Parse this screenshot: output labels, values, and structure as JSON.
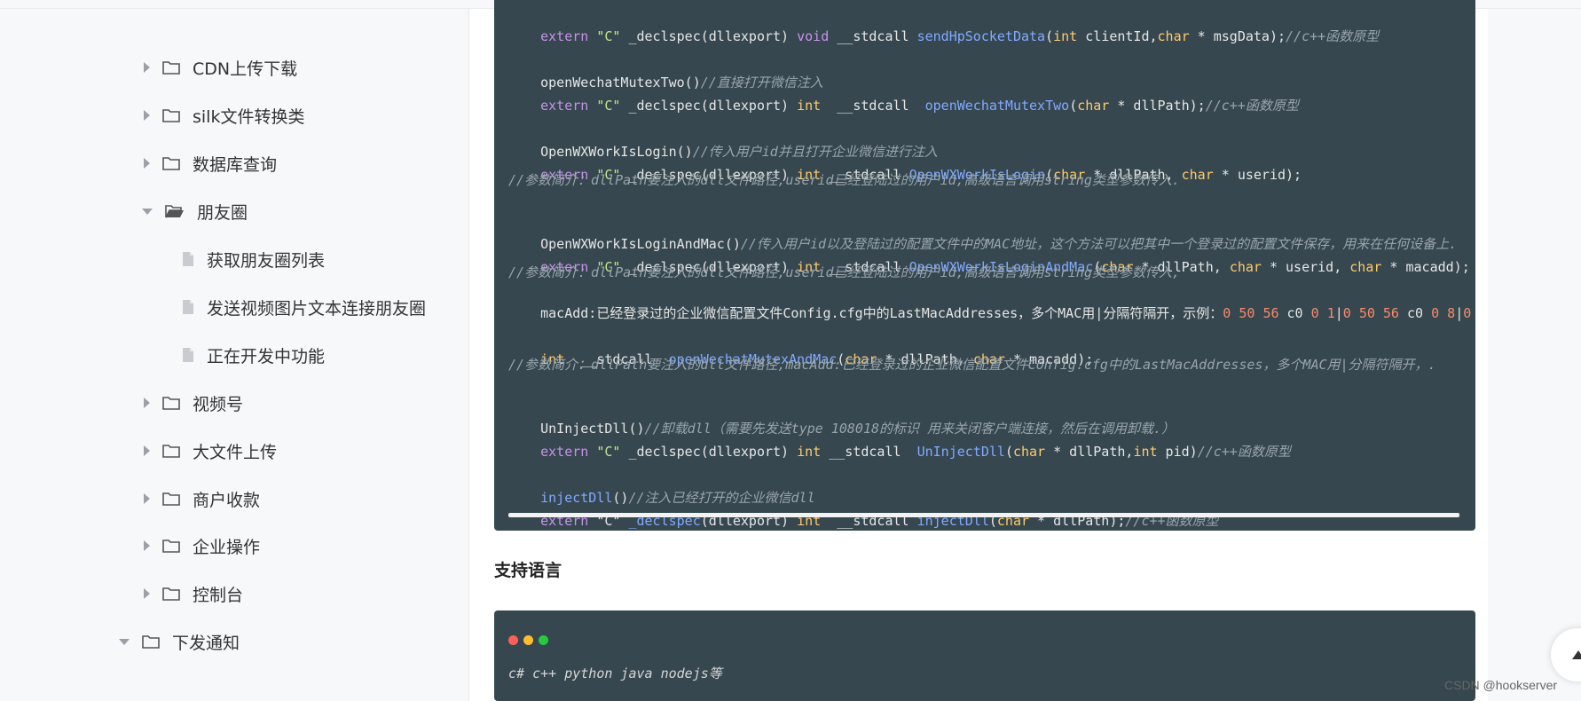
{
  "sidebar": {
    "items": [
      {
        "label": "CDN上传下载",
        "state": "collapsed"
      },
      {
        "label": "silk文件转换类",
        "state": "collapsed"
      },
      {
        "label": "数据库查询",
        "state": "collapsed"
      },
      {
        "label": "朋友圈",
        "state": "expanded",
        "children": [
          "获取朋友圈列表",
          "发送视频图片文本连接朋友圈",
          "正在开发中功能"
        ]
      },
      {
        "label": "视频号",
        "state": "collapsed"
      },
      {
        "label": "大文件上传",
        "state": "collapsed"
      },
      {
        "label": "商户收款",
        "state": "collapsed"
      },
      {
        "label": "企业操作",
        "state": "collapsed"
      },
      {
        "label": "控制台",
        "state": "collapsed"
      },
      {
        "label": "下发通知",
        "state": "expanded"
      }
    ]
  },
  "code": {
    "line1": [
      "extern",
      " \"C\"",
      " _declspec(dllexport) ",
      "void",
      " __stdcall ",
      "sendHpSocketData",
      "(",
      "int",
      " clientId,",
      "char",
      " * msgData);",
      "//c++函数原型"
    ],
    "line2": [
      "openWechatMutexTwo()",
      "//直接打开微信注入"
    ],
    "line3": [
      "extern",
      " \"C\"",
      " _declspec(dllexport) ",
      "int",
      "  __stdcall  ",
      "openWechatMutexTwo",
      "(",
      "char",
      " * dllPath);",
      "//c++函数原型"
    ],
    "line4": [
      "OpenWXWorkIsLogin()",
      "//传入用户id并且打开企业微信进行注入"
    ],
    "line5": [
      "extern",
      " \"C\"",
      " _declspec(dllexport) ",
      "int",
      " __stdcall ",
      "OpenWXWorkIsLogin",
      "(",
      "char",
      " * dllPath, ",
      "char",
      " * userid);"
    ],
    "line6": [
      "//参数简介：dllPath要注入的dll文件路径,userid已经登陆过的用户id,高级语言调用string类型参数传入."
    ],
    "line7": [
      "OpenWXWorkIsLoginAndMac()",
      "//传入用户id以及登陆过的配置文件中的MAC地址，这个方法可以把其中一个登录过的配置文件保存，用来在任何设备上."
    ],
    "line8": [
      "extern",
      " \"C\"",
      " _declspec(dllexport) ",
      "int",
      " __stdcall ",
      "OpenWXWorkIsLoginAndMac",
      "(",
      "char",
      " * dllPath, ",
      "char",
      " * userid, ",
      "char",
      " * macadd);"
    ],
    "line9": [
      "//参数简介：dllPath要注入的dll文件路径,userid已经登陆过的用户id,高级语言调用string类型参数传入,"
    ],
    "line10": [
      "macAdd:已经登录过的企业微信配置文件Config.cfg中的LastMacAddresses，多个MAC用|分隔符隔开，示例：",
      "0",
      " ",
      "50",
      " ",
      "56",
      " c0 ",
      "0",
      " ",
      "1",
      "|",
      "0",
      " ",
      "50",
      " ",
      "56",
      " c0 ",
      "0",
      " ",
      "8",
      "|",
      "0"
    ],
    "line11": [
      "int",
      "  __stdcall  ",
      "openWechatMutexAndMac",
      "(",
      "char",
      " * dllPath, ",
      "char",
      " * macadd);"
    ],
    "line12": [
      "//参数简介：dllPath要注入的dll文件路径,macAdd:已经登录过的企业微信配置文件Config.cfg中的LastMacAddresses，多个MAC用|分隔符隔开，."
    ],
    "line13": [
      "UnInjectDll()",
      "//卸载dll（需要先发送type 108018的标识 用来关闭客户端连接，然后在调用卸载.）"
    ],
    "line14": [
      "extern",
      " \"C\"",
      " _declspec(dllexport) ",
      "int",
      " __stdcall  ",
      "UnInjectDll",
      "(",
      "char",
      " * dllPath,",
      "int",
      " pid)",
      "//c++函数原型"
    ],
    "line15": [
      "injectDll",
      "()",
      "//注入已经打开的企业微信dll"
    ],
    "line16": [
      "extern",
      " \"C\" ",
      "_declspec",
      "(dllexport) ",
      "int",
      "  __stdcall ",
      "injectDll",
      "(",
      "char",
      " * dllPath);",
      "//c++函数原型"
    ]
  },
  "support": {
    "title": "支持语言",
    "languages": "c# c++ python java nodejs等"
  },
  "watermark": "CSDN @hookserver",
  "colors": {
    "code_bg": "#36474f",
    "keyword": "#c792ea",
    "string": "#c3e88d",
    "function": "#82aaff",
    "type": "#ffcb6b",
    "comment": "#9aa5ad",
    "number": "#f78c6c",
    "dot_red": "#ff5f56",
    "dot_yellow": "#ffbd2e",
    "dot_green": "#27c93f"
  },
  "icons": {
    "folder": "folder-icon",
    "folder_open": "folder-open-icon",
    "file": "file-icon",
    "caret_right": "caret-right-icon",
    "caret_down": "caret-down-icon",
    "back_to_top": "arrow-up-icon"
  }
}
